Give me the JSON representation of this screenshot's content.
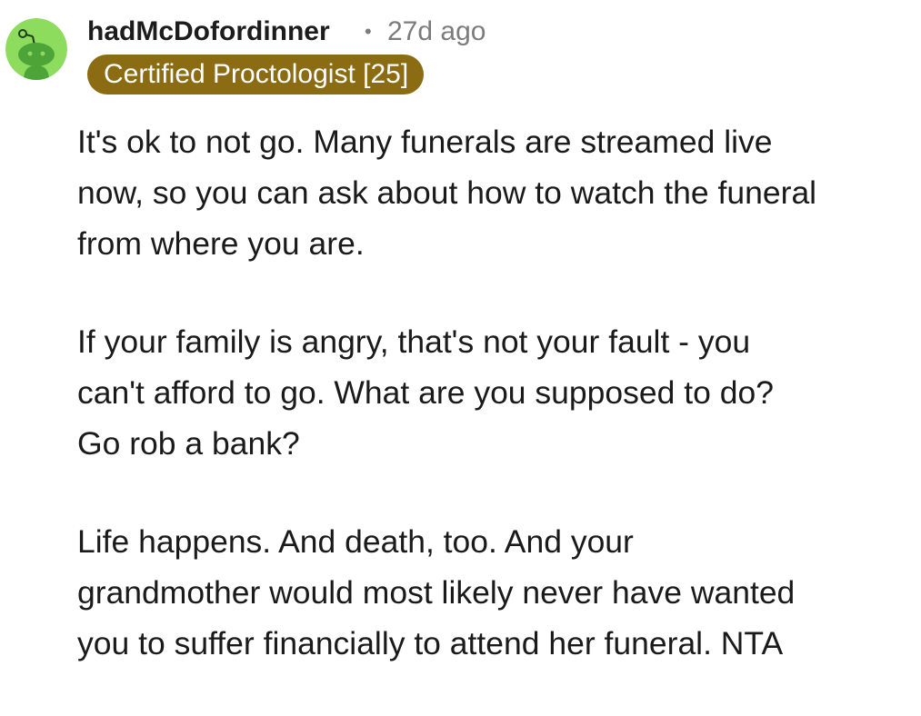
{
  "comment": {
    "username": "hadMcDofordinner",
    "separator": "•",
    "timestamp": "27d ago",
    "flair": "Certified Proctologist [25]",
    "avatar_icon": "snoo-avatar-icon",
    "colors": {
      "flair_bg": "#8b6c13",
      "avatar_bg": "#8ddc5e",
      "avatar_figure": "#4da53a"
    },
    "paragraphs": [
      [
        "It's ok to not go. Many funerals are streamed live",
        "now, so you can ask about how to watch the funeral",
        "from where you are."
      ],
      [
        "If your family is angry, that's not your fault - you",
        "can't afford to go. What are you supposed to do?",
        "Go rob a bank?"
      ],
      [
        "Life happens. And death, too. And your",
        "grandmother would most likely never have wanted",
        "you to suffer financially to attend her funeral. NTA"
      ]
    ]
  }
}
